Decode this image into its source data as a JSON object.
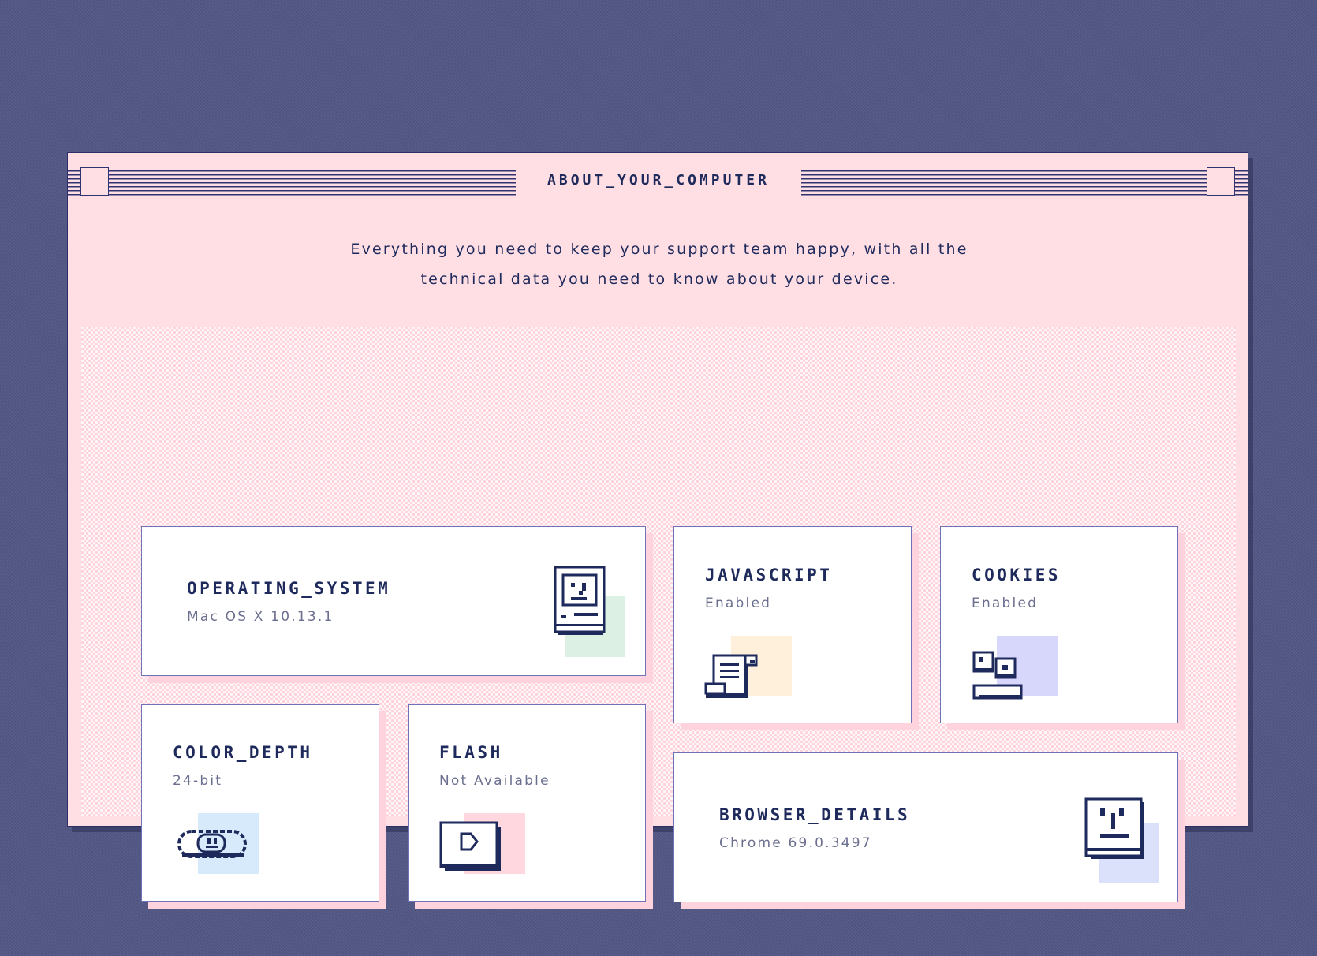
{
  "window": {
    "title": "ABOUT_YOUR_COMPUTER",
    "intro_line1": "Everything you need to keep your support team happy, with all the",
    "intro_line2": "technical data you need to know about your device."
  },
  "cards": {
    "operating_system": {
      "title": "OPERATING_SYSTEM",
      "value": "Mac OS X 10.13.1",
      "icon": "classic-computer-icon",
      "accent": "#dcf1e4"
    },
    "javascript": {
      "title": "JAVASCRIPT",
      "value": "Enabled",
      "icon": "scroll-document-icon",
      "accent": "#fff0dc"
    },
    "cookies": {
      "title": "COOKIES",
      "value": "Enabled",
      "icon": "cookie-plate-icon",
      "accent": "#d7d7fb"
    },
    "color_depth": {
      "title": "COLOR_DEPTH",
      "value": "24-bit",
      "icon": "eye-capsule-icon",
      "accent": "#d6eafb"
    },
    "flash": {
      "title": "FLASH",
      "value": "Not Available",
      "icon": "play-window-icon",
      "accent": "#ffd7df"
    },
    "browser_details": {
      "title": "BROWSER_DETAILS",
      "value": "Chrome 69.0.3497",
      "icon": "smiley-screen-icon",
      "accent": "#dbe0fb"
    }
  }
}
